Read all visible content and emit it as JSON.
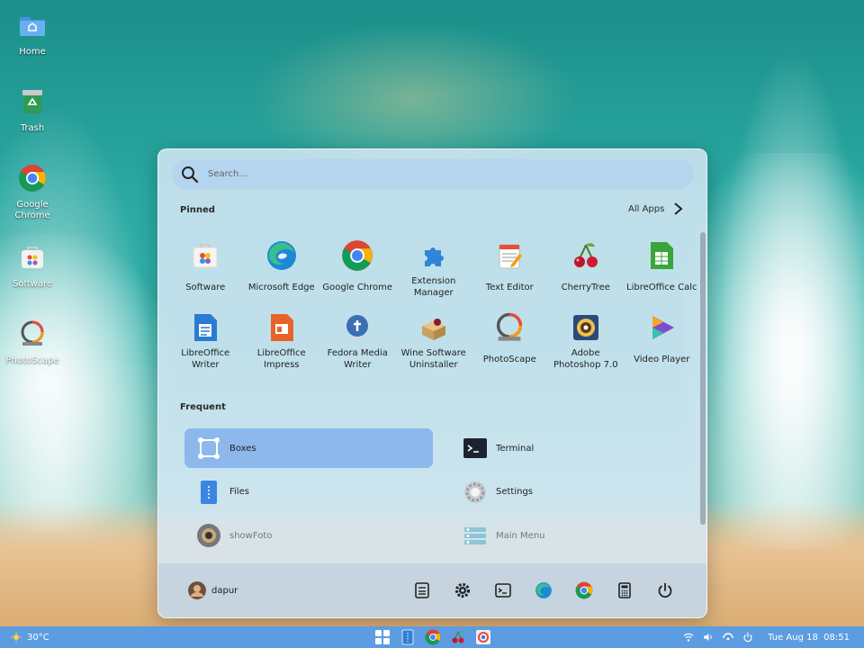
{
  "desktop": {
    "icons": [
      {
        "label": "Home",
        "icon": "folder-home-icon"
      },
      {
        "label": "Trash",
        "icon": "trash-icon"
      },
      {
        "label": "Google Chrome",
        "icon": "chrome-icon"
      },
      {
        "label": "Software",
        "icon": "software-icon"
      },
      {
        "label": "PhotoScape",
        "icon": "photoscape-icon"
      }
    ]
  },
  "menu": {
    "search_placeholder": "Search...",
    "pinned_title": "Pinned",
    "all_apps_label": "All Apps",
    "pinned": [
      {
        "label": "Software",
        "icon": "software-icon"
      },
      {
        "label": "Microsoft Edge",
        "icon": "edge-icon"
      },
      {
        "label": "Google Chrome",
        "icon": "chrome-icon"
      },
      {
        "label": "Extension Manager",
        "icon": "puzzle-icon"
      },
      {
        "label": "Text Editor",
        "icon": "text-editor-icon"
      },
      {
        "label": "CherryTree",
        "icon": "cherry-icon"
      },
      {
        "label": "LibreOffice Calc",
        "icon": "calc-icon"
      },
      {
        "label": "LibreOffice Writer",
        "icon": "writer-icon"
      },
      {
        "label": "LibreOffice Impress",
        "icon": "impress-icon"
      },
      {
        "label": "Fedora Media Writer",
        "icon": "fedora-icon"
      },
      {
        "label": "Wine Software Uninstaller",
        "icon": "wine-icon"
      },
      {
        "label": "PhotoScape",
        "icon": "photoscape-icon"
      },
      {
        "label": "Adobe Photoshop 7.0",
        "icon": "photoshop-icon"
      },
      {
        "label": "Video Player",
        "icon": "video-player-icon"
      }
    ],
    "frequent_title": "Frequent",
    "frequent": [
      {
        "label": "Boxes",
        "icon": "boxes-icon"
      },
      {
        "label": "Terminal",
        "icon": "terminal-icon"
      },
      {
        "label": "Files",
        "icon": "files-icon"
      },
      {
        "label": "Settings",
        "icon": "settings-gear-icon"
      },
      {
        "label": "showFoto",
        "icon": "showfoto-icon"
      },
      {
        "label": "Main Menu",
        "icon": "main-menu-icon"
      }
    ],
    "footer": {
      "user_name": "dapur",
      "buttons": [
        "document-icon",
        "gear-icon",
        "terminal-icon",
        "edge-icon",
        "chrome-icon",
        "calculator-icon",
        "power-icon"
      ]
    }
  },
  "taskbar": {
    "weather": "30°C",
    "apps": [
      "start-icon",
      "files-icon",
      "chrome-icon",
      "cherry-icon",
      "photoscape-icon"
    ],
    "tray": [
      "wifi-icon",
      "volume-icon",
      "network-icon",
      "power-icon"
    ],
    "clock": "Tue Aug 18  08:51"
  },
  "colors": {
    "taskbar": "#5b9de0",
    "active_item": "#78aaeb",
    "menu_bg": "#d6e8f4"
  }
}
